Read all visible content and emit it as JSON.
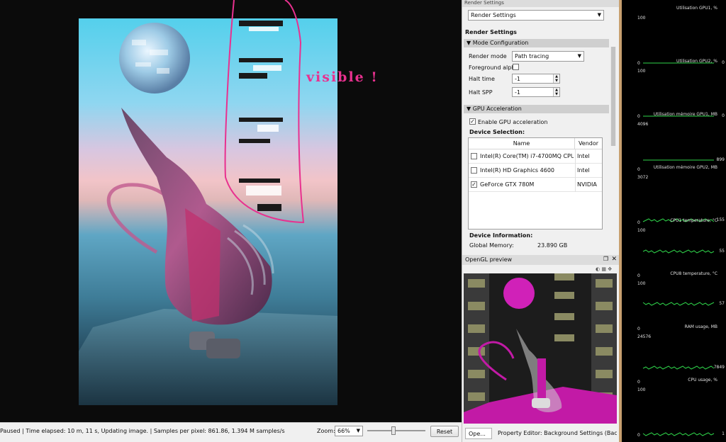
{
  "viewport": {
    "annotation": "visible !"
  },
  "statusbar": {
    "status": "Paused | Time elapsed: 10 m, 11 s, Updating image. | Samples per pixel: 861.86, 1.394 M samples/s",
    "zoom_label": "Zoom:",
    "zoom_value": "66%",
    "zoom_slider_fraction": 0.45,
    "reset_label": "Reset"
  },
  "settings": {
    "window_title": "Render Settings",
    "selector_value": "Render Settings",
    "heading": "Render Settings",
    "mode_section": "Mode Configuration",
    "render_mode_label": "Render mode",
    "render_mode_value": "Path tracing",
    "foreground_alpha_label": "Foreground alpha",
    "foreground_alpha_checked": false,
    "halt_time_label": "Halt time",
    "halt_time_value": "-1",
    "halt_spp_label": "Halt SPP",
    "halt_spp_value": "-1",
    "gpu_section": "GPU Acceleration",
    "enable_gpu_label": "Enable GPU acceleration",
    "enable_gpu_checked": true,
    "device_selection_label": "Device Selection:",
    "table_headers": {
      "name": "Name",
      "vendor": "Vendor"
    },
    "devices": [
      {
        "name": "Intel(R) Core(TM) i7-4700MQ CPU ...",
        "vendor": "Intel",
        "checked": false
      },
      {
        "name": "Intel(R) HD Graphics 4600",
        "vendor": "Intel",
        "checked": false
      },
      {
        "name": "GeForce GTX 780M",
        "vendor": "NVIDIA",
        "checked": true
      }
    ],
    "device_info_label": "Device Information:",
    "global_memory_label": "Global Memory:",
    "global_memory_value": "23.890 GB"
  },
  "preview": {
    "title": "OpenGL preview",
    "tab_short": "Ope...",
    "tab_property": "Property Editor: Background Settings (Backgrou..."
  },
  "monitor": {
    "graphs": [
      {
        "title": "Utilisation GPU1, %",
        "max": "100",
        "min": "0",
        "current": "0",
        "level": 0.0
      },
      {
        "title": "Utilisation GPU2, %",
        "max": "100",
        "min": "0",
        "current": "0",
        "level": 0.0
      },
      {
        "title": "Utilisation mémoire GPU1, MB",
        "max": "4096",
        "min": "0",
        "current": "899",
        "level": 0.22
      },
      {
        "title": "Utilisation mémoire GPU2, MB",
        "max": "3072",
        "min": "0",
        "current": "155",
        "level": 0.05
      },
      {
        "title": "CPU1 temperature, °C",
        "max": "100",
        "min": "0",
        "current": "55",
        "level": 0.55
      },
      {
        "title": "CPU8 temperature, °C",
        "max": "100",
        "min": "0",
        "current": "57",
        "level": 0.57
      },
      {
        "title": "RAM usage, MB",
        "max": "24576",
        "min": "0",
        "current": "7849",
        "level": 0.32
      },
      {
        "title": "CPU usage, %",
        "max": "100",
        "min": "0",
        "current": "1",
        "level": 0.02
      }
    ]
  },
  "colors": {
    "annotation": "#e8318f",
    "graph_line": "#2fd34a",
    "monitor_bg": "#000000",
    "preview_magenta": "#c21aa6"
  }
}
